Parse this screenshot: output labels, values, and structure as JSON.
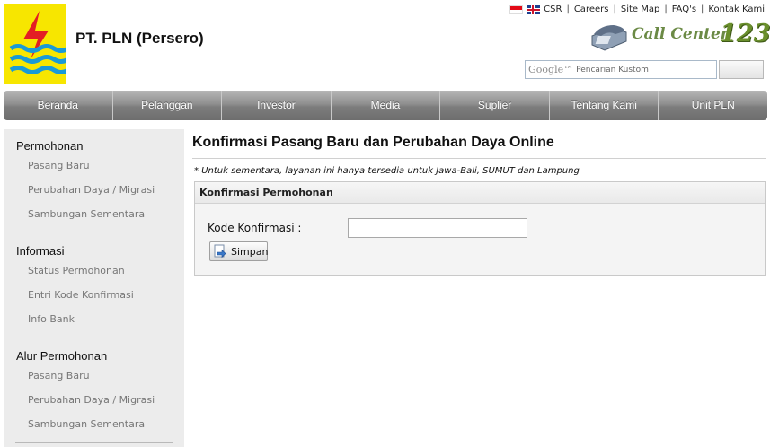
{
  "header": {
    "company_name": "PT. PLN (Persero)",
    "toplinks": [
      "CSR",
      "Careers",
      "Site Map",
      "FAQ's",
      "Kontak Kami"
    ],
    "callcenter_text": "Call Center",
    "callcenter_number": "123",
    "search": {
      "engine_label": "Google™",
      "placeholder": "Pencarian Kustom"
    }
  },
  "nav": {
    "items": [
      "Beranda",
      "Pelanggan",
      "Investor",
      "Media",
      "Suplier",
      "Tentang Kami",
      "Unit PLN"
    ]
  },
  "sidebar": {
    "sections": [
      {
        "heading": "Permohonan",
        "items": [
          "Pasang Baru",
          "Perubahan Daya / Migrasi",
          "Sambungan Sementara"
        ]
      },
      {
        "heading": "Informasi",
        "items": [
          "Status Permohonan",
          "Entri Kode Konfirmasi",
          "Info Bank"
        ]
      },
      {
        "heading": "Alur Permohonan",
        "items": [
          "Pasang Baru",
          "Perubahan Daya / Migrasi",
          "Sambungan Sementara"
        ]
      }
    ]
  },
  "main": {
    "title": "Konfirmasi Pasang Baru dan Perubahan Daya Online",
    "notice": "* Untuk sementara, layanan ini hanya tersedia untuk Jawa-Bali, SUMUT dan Lampung",
    "panel": {
      "heading": "Konfirmasi Permohonan",
      "field_label": "Kode Konfirmasi :",
      "field_value": "",
      "save_label": "Simpan"
    }
  },
  "colors": {
    "logo_background": "#f7e600",
    "logo_red": "#e31e24",
    "logo_blue": "#1a9ad6",
    "nav_background": "#8f8f8f",
    "sidebar_background": "#ececec"
  }
}
